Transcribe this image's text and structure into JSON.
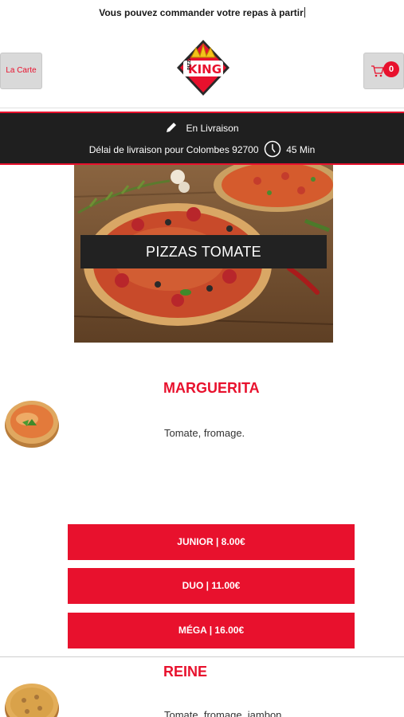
{
  "banner": {
    "text": "Vous pouvez commander votre repas à partir"
  },
  "header": {
    "carte_label": "La Carte",
    "logo_alt": "KING",
    "cart_count": "0"
  },
  "delivery": {
    "mode": "En Livraison",
    "delay_text": "Délai de livraison pour Colombes 92700",
    "delay_value": "45 Min"
  },
  "category": {
    "title": "PIZZAS TOMATE"
  },
  "products": [
    {
      "name": "MARGUERITA",
      "description": "Tomate, fromage.",
      "sizes": [
        {
          "label": "JUNIOR | 8.00€"
        },
        {
          "label": "DUO | 11.00€"
        },
        {
          "label": "MÉGA | 16.00€"
        }
      ]
    },
    {
      "name": "REINE",
      "description": "Tomate, fromage, jambon"
    }
  ],
  "colors": {
    "accent": "#e8112d",
    "bar": "#1f1f1f",
    "button_grey": "#d9d9d9"
  }
}
